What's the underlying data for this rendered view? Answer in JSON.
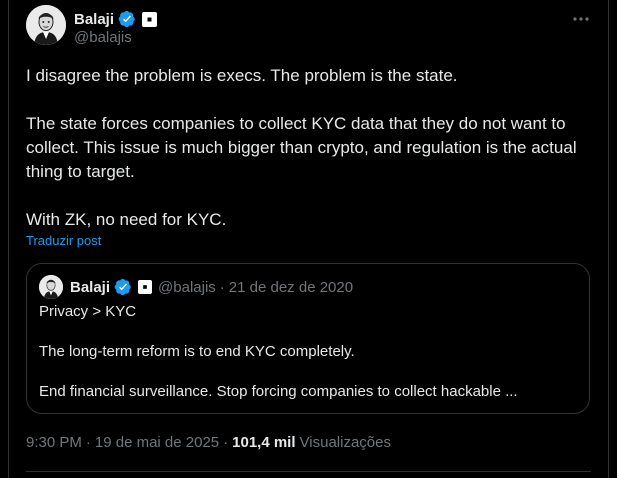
{
  "author": {
    "name": "Balaji",
    "handle": "@balajis"
  },
  "tweet": {
    "paragraphs": [
      "I disagree the problem is execs. The problem is the state.",
      "The state forces companies to collect KYC data that they do not want to collect. This issue is much bigger than crypto, and regulation is the actual thing to target.",
      "With ZK, no need for KYC."
    ],
    "translate_label": "Traduzir post"
  },
  "quoted": {
    "name": "Balaji",
    "handle": "@balajis",
    "separator": "·",
    "date": "21 de dez de 2020",
    "paragraphs": [
      "Privacy > KYC",
      "The long-term reform is to end KYC completely.",
      "End financial surveillance. Stop forcing companies to collect hackable ..."
    ]
  },
  "meta": {
    "time": "9:30 PM",
    "separator1": "·",
    "date": "19 de mai de 2025",
    "separator2": "·",
    "views_count": "101,4 mil",
    "views_label": "Visualizações"
  },
  "colors": {
    "background": "#000000",
    "text": "#e7e9ea",
    "secondary": "#71767b",
    "accent": "#1d9bf0",
    "border": "#2f3336"
  },
  "icons": {
    "verified": "verified-badge-icon",
    "affiliate": "affiliate-badge-icon",
    "more": "more-options-icon"
  }
}
